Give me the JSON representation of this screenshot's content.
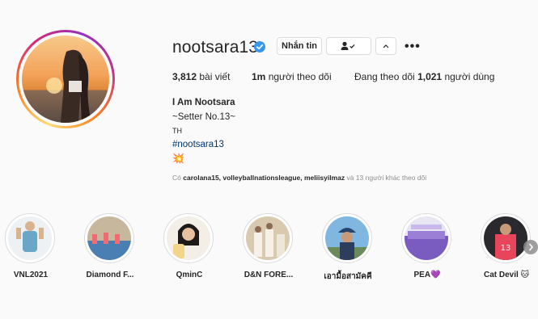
{
  "profile": {
    "username": "nootsara13",
    "buttons": {
      "message": "Nhắn tin"
    },
    "stats": {
      "posts_count": "3,812",
      "posts_label": "bài viết",
      "followers_count": "1m",
      "followers_label": "người theo dõi",
      "following_prefix": "Đang theo dõi",
      "following_count": "1,021",
      "following_suffix": "người dùng"
    },
    "bio": {
      "name": "I Am Nootsara",
      "line1": "~Setter No.13~",
      "line2": "TH",
      "hashtag": "#nootsara13",
      "emoji": "💥"
    },
    "followed_by": {
      "prefix": "Có",
      "users": "carolana15, volleyballnationsleague, meliisyilmaz",
      "suffix": "và 13 người khác theo dõi"
    }
  },
  "highlights": [
    {
      "label": "VNL2021"
    },
    {
      "label": "Diamond F..."
    },
    {
      "label": "QminC"
    },
    {
      "label": "D&N FORE..."
    },
    {
      "label": "เอามื้อสามัคคี"
    },
    {
      "label": "PEA💜"
    },
    {
      "label": "Cat Devil 🐱"
    }
  ],
  "colors": {
    "link": "#00376b",
    "verified": "#3897f0",
    "secondary_text": "#8e8e8e"
  }
}
